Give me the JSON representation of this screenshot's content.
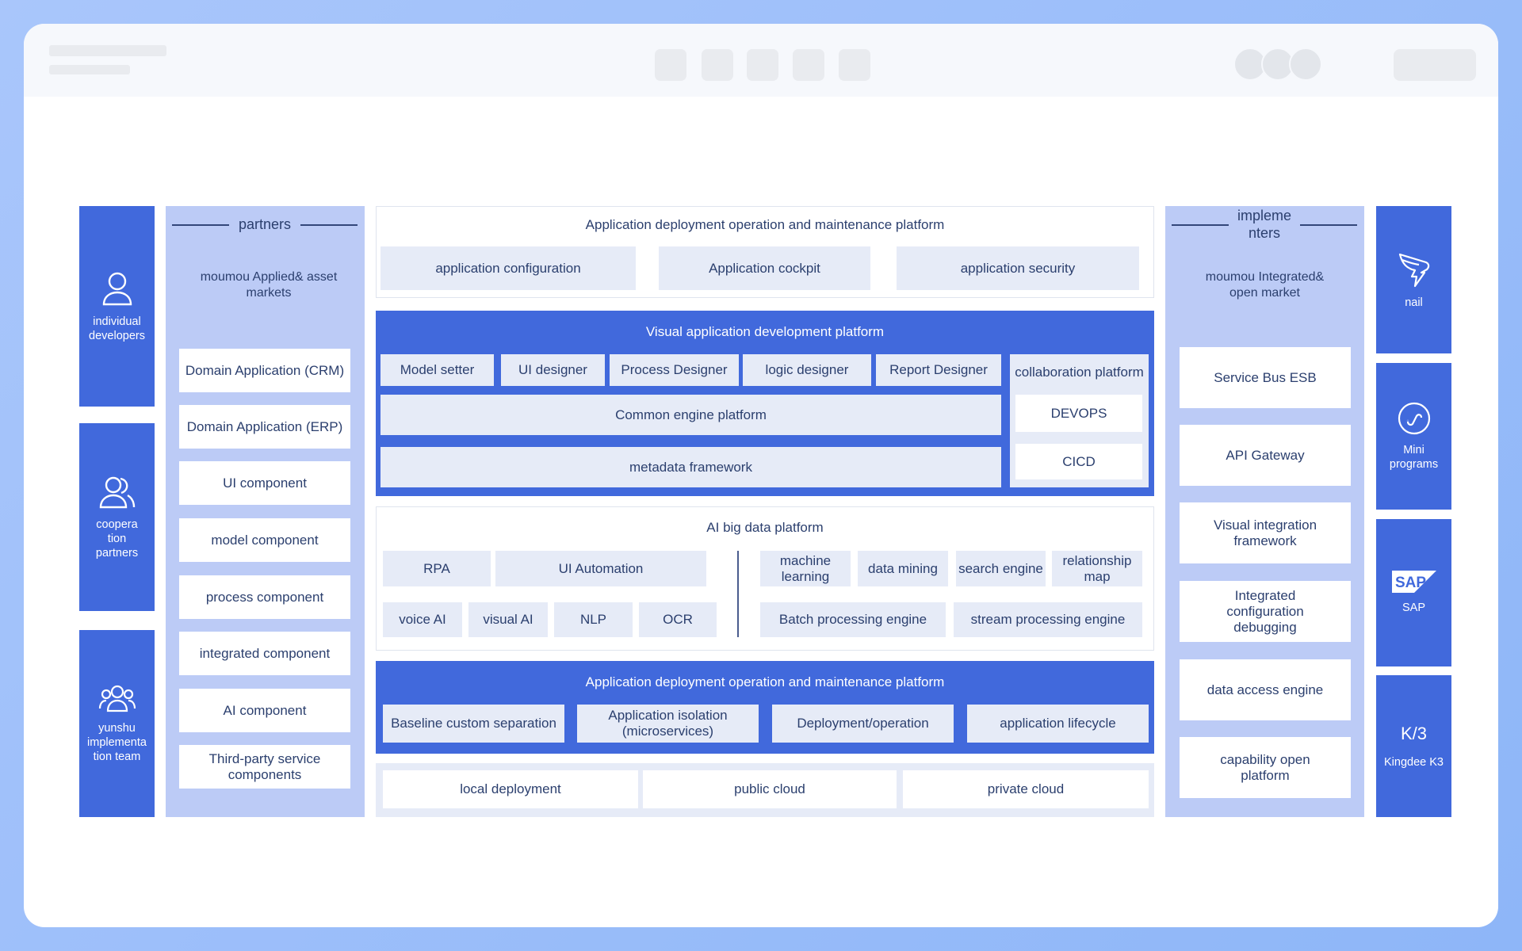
{
  "left_actors": [
    {
      "label": "individual developers",
      "icon": "user-icon"
    },
    {
      "label": "coopera tion partners",
      "icon": "users-icon"
    },
    {
      "label": "yunshu implementa tion team",
      "icon": "team-icon"
    }
  ],
  "partners": {
    "title": "partners",
    "subtitle": "moumou Applied& asset markets",
    "items": [
      "Domain Application (CRM)",
      "Domain Application (ERP)",
      "UI component",
      "model component",
      "process component",
      "integrated component",
      "AI component",
      "Third-party service components"
    ]
  },
  "ops_top": {
    "title": "Application deployment operation and maintenance platform",
    "items": [
      "application configuration",
      "Application cockpit",
      "application security"
    ]
  },
  "visual_dev": {
    "title": "Visual application development platform",
    "designers": [
      "Model setter",
      "UI designer",
      "Process Designer",
      "logic designer",
      "Report Designer"
    ],
    "common_engine": "Common engine platform",
    "metadata": "metadata framework",
    "collab_title": "collaboration platform",
    "devops": "DEVOPS",
    "cicd": "CICD"
  },
  "ai_bigdata": {
    "title": "AI big data platform",
    "left_row1": [
      "RPA",
      "UI Automation"
    ],
    "left_row2": [
      "voice AI",
      "visual AI",
      "NLP",
      "OCR"
    ],
    "right_row1": [
      "machine learning",
      "data mining",
      "search engine",
      "relationship map"
    ],
    "right_row2": [
      "Batch processing engine",
      "stream processing engine"
    ]
  },
  "ops_bottom": {
    "title": "Application deployment operation and maintenance platform",
    "items": [
      "Baseline custom separation",
      "Application isolation (microservices)",
      "Deployment/operation",
      "application lifecycle"
    ]
  },
  "deployment": [
    "local deployment",
    "public cloud",
    "private cloud"
  ],
  "implementers": {
    "title_line1": "impleme",
    "title_line2": "nters",
    "subtitle": "moumou Integrated& open market",
    "items": [
      "Service Bus ESB",
      "API Gateway",
      "Visual integration framework",
      "Integrated configuration debugging",
      "data access engine",
      "capability open platform"
    ]
  },
  "right_apps": [
    {
      "label": "nail",
      "icon": "dingtalk-icon"
    },
    {
      "label": "Mini programs",
      "icon": "mini-program-icon"
    },
    {
      "label": "SAP",
      "icon": "sap-logo-icon",
      "logo_text": "SAP"
    },
    {
      "label": "Kingdee K3",
      "icon": "kingdee-k3-icon",
      "logo_text": "K/3"
    }
  ],
  "colors": {
    "primary_blue": "#4169dc",
    "lavender": "#bccbf6",
    "light_tile": "#e6ebf7",
    "text_dark": "#2b3f6e",
    "frame_gradient": "#a9c6fb"
  }
}
